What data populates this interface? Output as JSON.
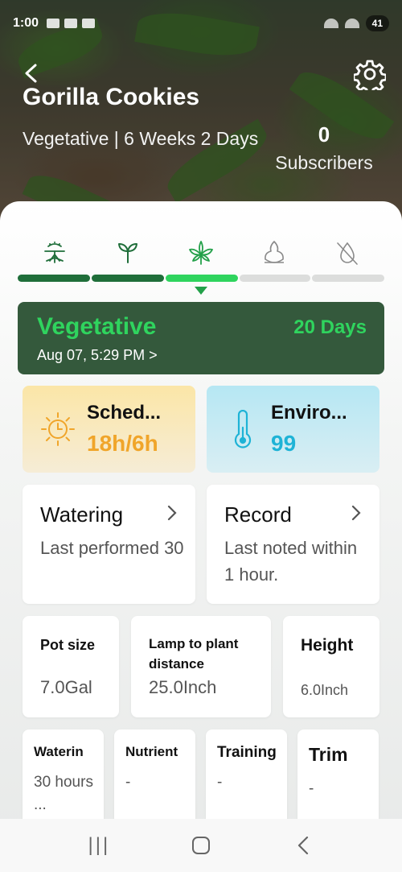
{
  "status_bar": {
    "time": "1:00",
    "battery": "41"
  },
  "header": {
    "title": "Gorilla Cookies",
    "stage_line": "Vegetative | 6 Weeks 2 Days",
    "subscriber_count": "0",
    "subscriber_label": "Subscribers"
  },
  "stages": [
    {
      "icon": "seedling-roots-icon",
      "state": "done"
    },
    {
      "icon": "sprout-icon",
      "state": "done"
    },
    {
      "icon": "cannabis-leaf-icon",
      "state": "current"
    },
    {
      "icon": "bud-icon",
      "state": "upcoming"
    },
    {
      "icon": "harvest-off-icon",
      "state": "upcoming"
    }
  ],
  "colors": {
    "done": "#1f6e3a",
    "current": "#2fd45e",
    "upcoming": "#dcdddc",
    "accent_green": "#2fd45e",
    "schedule_orange": "#f0a52a",
    "environment_blue": "#1eb3d6"
  },
  "current_stage": {
    "name": "Vegetative",
    "days": "20 Days",
    "date": "Aug 07, 5:29 PM >"
  },
  "schedule": {
    "title": "Sched...",
    "value": "18h/6h",
    "icon": "sun-clock-icon"
  },
  "environment": {
    "title": "Enviro...",
    "value": "99",
    "icon": "thermometer-icon"
  },
  "watering": {
    "title": "Watering",
    "body": "Last performed 30"
  },
  "record": {
    "title": "Record",
    "body": "Last noted within 1 hour."
  },
  "metrics": {
    "pot_size": {
      "label": "Pot size",
      "value": "7.0Gal"
    },
    "lamp_distance": {
      "label": "Lamp to plant distance",
      "value": "25.0Inch"
    },
    "height": {
      "label": "Height",
      "value": "6.0Inch"
    }
  },
  "small_cards": {
    "watering": {
      "label": "Waterin",
      "value": "30 hours ..."
    },
    "nutrient": {
      "label": "Nutrient",
      "value": "-"
    },
    "training": {
      "label": "Training",
      "value": "-"
    },
    "trim": {
      "label": "Trim",
      "value": "-"
    }
  },
  "nav": {
    "recents": "|||"
  }
}
